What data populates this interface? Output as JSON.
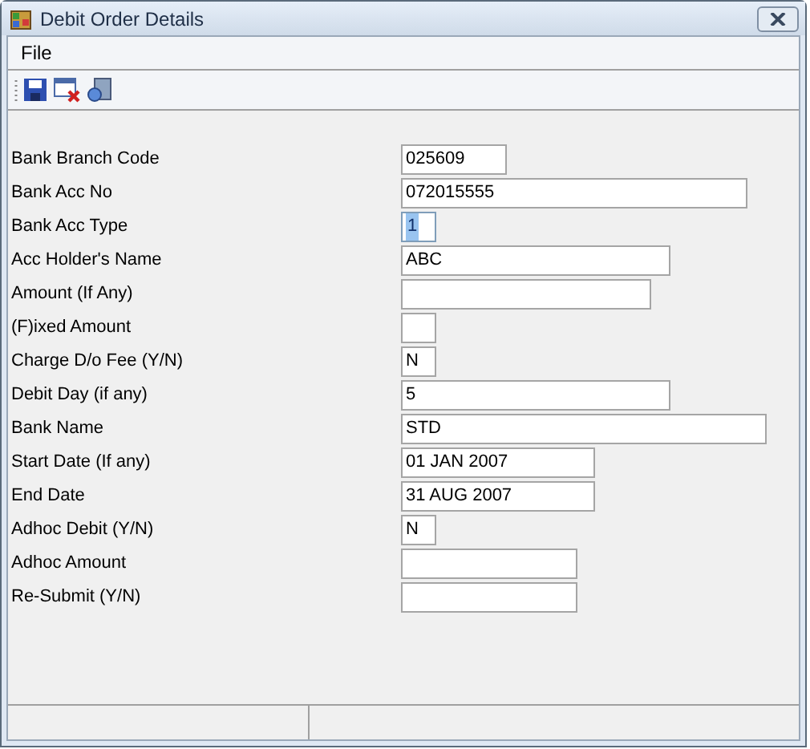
{
  "window": {
    "title": "Debit Order Details"
  },
  "menu": [
    "File"
  ],
  "fields": [
    {
      "label": "Bank Branch Code",
      "value": "025609",
      "selected": false
    },
    {
      "label": "Bank Acc No",
      "value": "072015555",
      "selected": false
    },
    {
      "label": "Bank Acc Type",
      "value": "1",
      "selected": true
    },
    {
      "label": "Acc Holder's Name",
      "value": "ABC",
      "selected": false
    },
    {
      "label": "Amount (If Any)",
      "selected": false
    },
    {
      "label": "(F)ixed Amount",
      "selected": false
    },
    {
      "label": "Charge D/o Fee (Y/N)",
      "value": "N",
      "selected": false
    },
    {
      "label": "Debit Day (if any)",
      "value": "5",
      "selected": false
    },
    {
      "label": "Bank Name",
      "value": "STD",
      "selected": false
    },
    {
      "label": "Start Date (If any)",
      "value": "01 JAN 2007",
      "selected": false
    },
    {
      "label": "End Date",
      "value": "31 AUG 2007",
      "selected": false
    },
    {
      "label": "Adhoc Debit (Y/N)",
      "value": "N",
      "selected": false
    },
    {
      "label": "Adhoc Amount",
      "selected": false
    },
    {
      "label": "Re-Submit (Y/N)",
      "selected": false
    }
  ]
}
